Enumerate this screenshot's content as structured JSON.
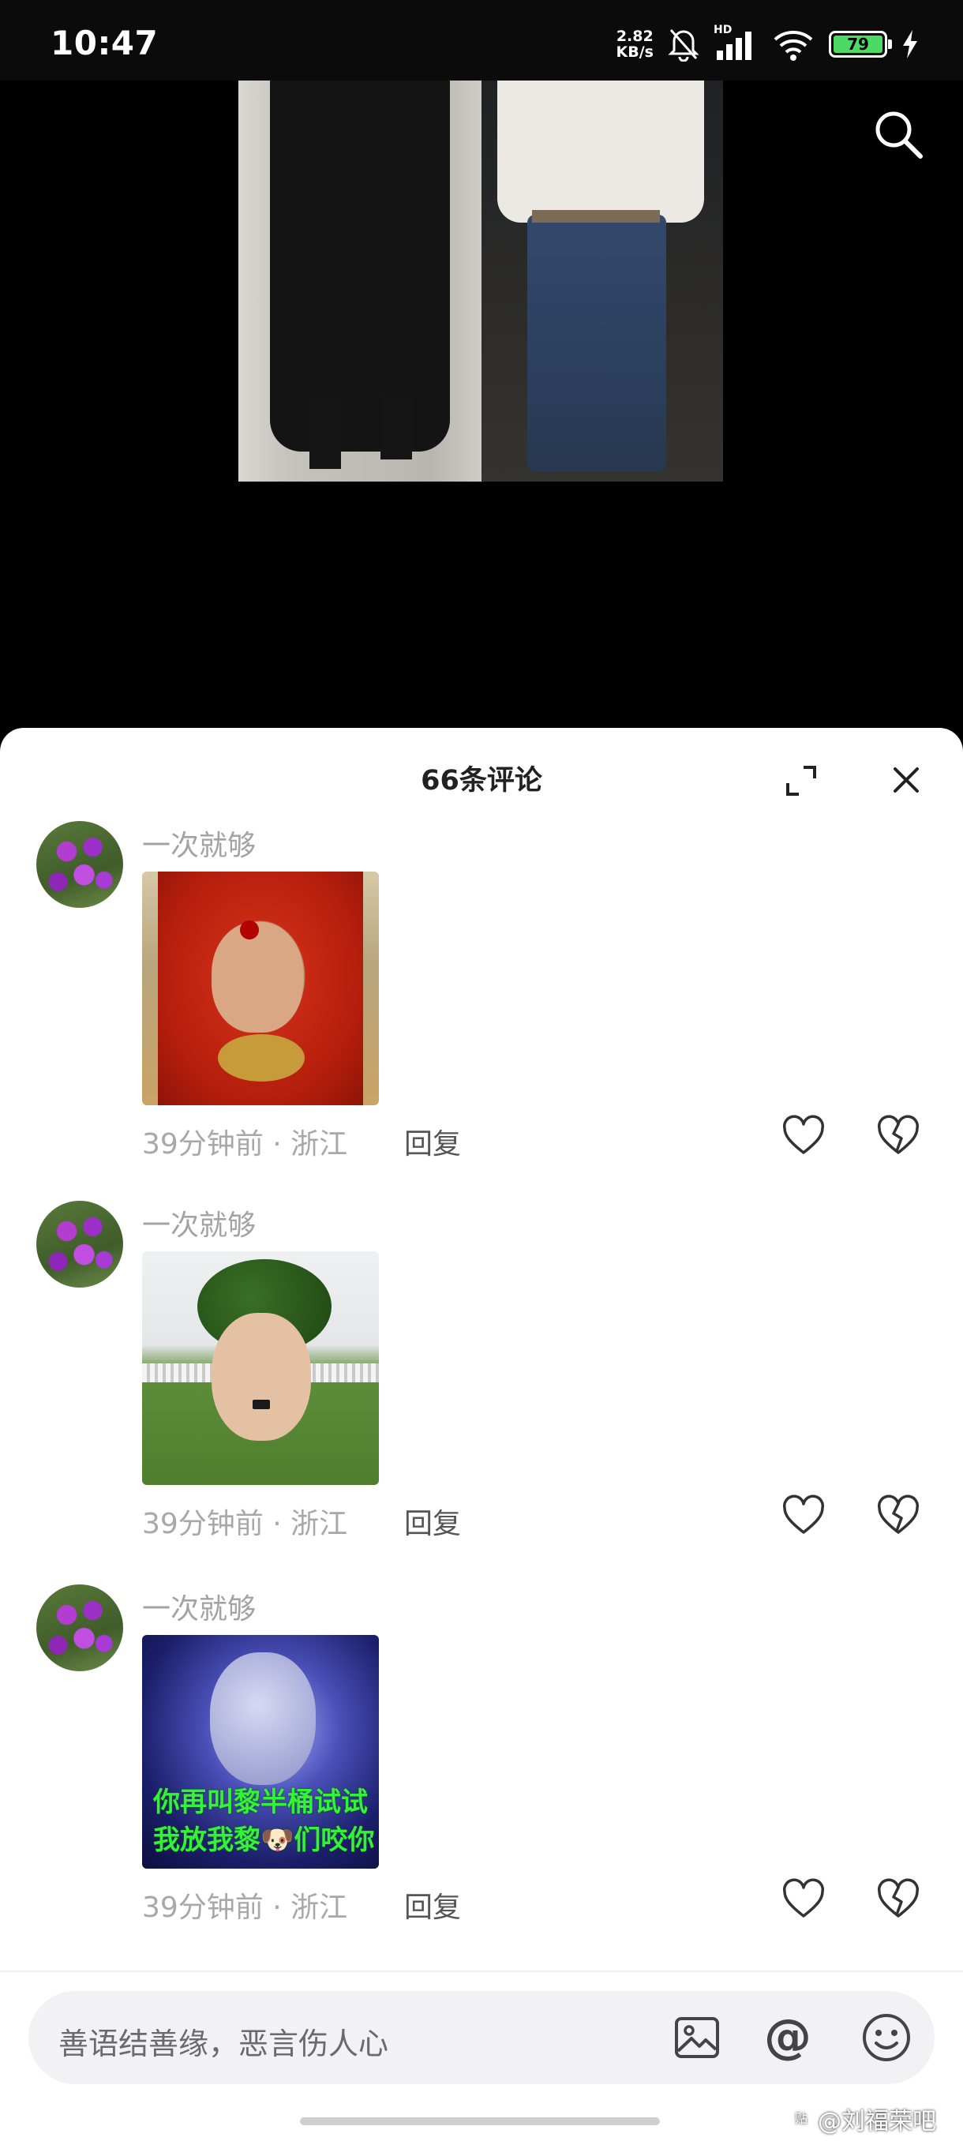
{
  "status_bar": {
    "time": "10:47",
    "net_speed_value": "2.82",
    "net_speed_unit": "KB/s",
    "hd_label": "HD",
    "battery": "79"
  },
  "sheet": {
    "title": "66条评论"
  },
  "comments": [
    {
      "username": "一次就够",
      "meta": "39分钟前 · 浙江",
      "reply": "回复"
    },
    {
      "username": "一次就够",
      "meta": "39分钟前 · 浙江",
      "reply": "回复"
    },
    {
      "username": "一次就够",
      "meta": "39分钟前 · 浙江",
      "reply": "回复",
      "image_caption_line1": "你再叫黎半桶试试",
      "image_caption_line2": "我放我黎🐶们咬你"
    }
  ],
  "input": {
    "placeholder": "善语结善缘，恶言伤人心",
    "at_symbol": "@"
  },
  "watermark": {
    "badge": "贴",
    "text": "@刘福荣吧"
  },
  "icons": {
    "search": "search-icon",
    "expand": "expand-icon",
    "close": "close-icon",
    "like": "heart-icon",
    "dislike": "broken-heart-icon",
    "picture": "image-icon",
    "emoji": "emoji-icon"
  },
  "colors": {
    "sheet_bg": "#ffffff",
    "username": "#a3a3a3",
    "battery": "#4cd964",
    "caption": "#34f13a"
  }
}
